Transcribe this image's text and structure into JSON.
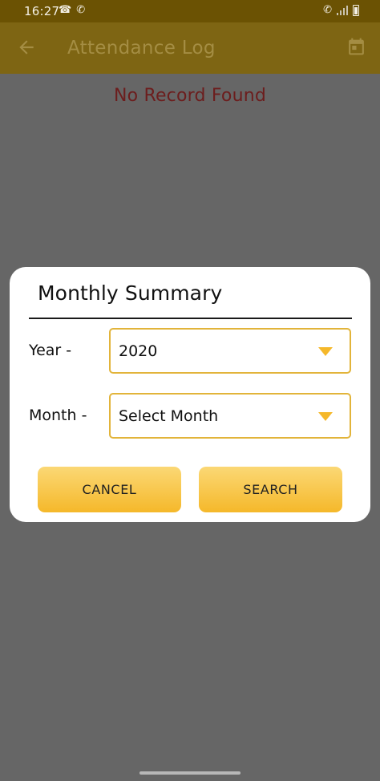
{
  "status_bar": {
    "time": "16:27"
  },
  "app_bar": {
    "title": "Attendance Log",
    "back_icon": "arrow-left-icon",
    "action_icon": "calendar-icon"
  },
  "main": {
    "empty_message": "No Record Found"
  },
  "dialog": {
    "title": "Monthly Summary",
    "year": {
      "label": "Year -",
      "value": "2020"
    },
    "month": {
      "label": "Month -",
      "value": "Select Month"
    },
    "cancel_label": "CANCEL",
    "search_label": "SEARCH"
  },
  "colors": {
    "accent": "#F5B82A",
    "select_border": "#E2B43A",
    "empty_message": "#6C1D1D",
    "app_bar": "#7E6513",
    "overlay": "#666666"
  }
}
